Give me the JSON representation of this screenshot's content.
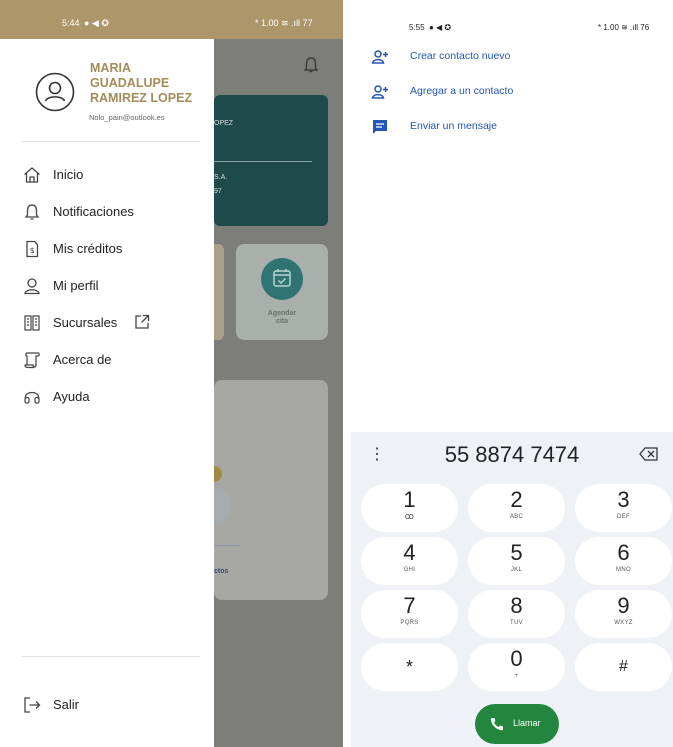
{
  "left_screen": {
    "status": {
      "time": "5:44",
      "right": "* 1.00 ≋ .ıll 77"
    },
    "user": {
      "name_lines": [
        "MARIA",
        "GUADALUPE",
        "RAMIREZ LOPEZ"
      ],
      "email": "Nolo_pain@outlook.es"
    },
    "menu": [
      {
        "label": "Inicio",
        "icon": "home-icon"
      },
      {
        "label": "Notificaciones",
        "icon": "bell-icon"
      },
      {
        "label": "Mis créditos",
        "icon": "credit-document-icon"
      },
      {
        "label": "Mi perfil",
        "icon": "person-icon"
      },
      {
        "label": "Sucursales",
        "icon": "branches-icon",
        "trailing_icon": "external-link-icon"
      },
      {
        "label": "Acerca de",
        "icon": "scroll-icon"
      },
      {
        "label": "Ayuda",
        "icon": "headset-icon"
      }
    ],
    "logout_label": "Salir",
    "background": {
      "card_text_1": "OPEZ",
      "card_text_2": "S.A.",
      "card_text_3": "97",
      "tile_label_1": "Agendar",
      "tile_label_2": "cita",
      "panel_text": "ctos"
    }
  },
  "right_screen": {
    "status": {
      "time": "5:55",
      "right": "* 1.00 ≋ .ıll 76"
    },
    "actions": [
      {
        "label": "Crear contacto nuevo",
        "icon": "add-person-icon"
      },
      {
        "label": "Agregar a un contacto",
        "icon": "add-person-icon"
      },
      {
        "label": "Enviar un mensaje",
        "icon": "message-icon"
      }
    ],
    "dialer": {
      "number": "55 8874 7474",
      "keys": [
        {
          "digit": "1",
          "sub": "ꝏ"
        },
        {
          "digit": "2",
          "sub": "ABC"
        },
        {
          "digit": "3",
          "sub": "DEF"
        },
        {
          "digit": "4",
          "sub": "GHI"
        },
        {
          "digit": "5",
          "sub": "JKL"
        },
        {
          "digit": "6",
          "sub": "MNO"
        },
        {
          "digit": "7",
          "sub": "PQRS"
        },
        {
          "digit": "8",
          "sub": "TUV"
        },
        {
          "digit": "9",
          "sub": "WXYZ"
        },
        {
          "digit": "*",
          "sub": ""
        },
        {
          "digit": "0",
          "sub": "+"
        },
        {
          "digit": "#",
          "sub": ""
        }
      ],
      "call_label": "Llamar"
    }
  },
  "colors": {
    "accent_gold": "#a48b5c",
    "status_bar": "#ad966a",
    "link_blue": "#2356b8",
    "call_green": "#22863f",
    "dark_teal": "#1e4a4b"
  }
}
